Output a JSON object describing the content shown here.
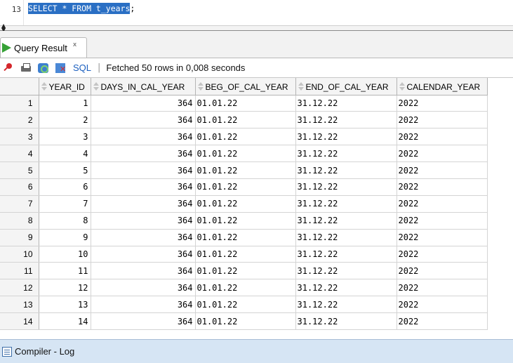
{
  "editor": {
    "line_number": "13",
    "selected_code": "SELECT * FROM t_years",
    "code_suffix": ";"
  },
  "result_tab": {
    "label": "Query Result",
    "close_glyph": "x",
    "icon": "run-triangle-icon"
  },
  "toolbar": {
    "icons": [
      "pin-icon",
      "print-icon",
      "refresh-icon",
      "delete-icon"
    ],
    "sql_link": "SQL",
    "separator": "|",
    "status": "Fetched 50 rows in 0,008 seconds"
  },
  "grid": {
    "columns": [
      "YEAR_ID",
      "DAYS_IN_CAL_YEAR",
      "BEG_OF_CAL_YEAR",
      "END_OF_CAL_YEAR",
      "CALENDAR_YEAR"
    ],
    "rows": [
      {
        "n": "1",
        "year_id": "1",
        "days": "364",
        "beg": "01.01.22",
        "end": "31.12.22",
        "cal": "2022"
      },
      {
        "n": "2",
        "year_id": "2",
        "days": "364",
        "beg": "01.01.22",
        "end": "31.12.22",
        "cal": "2022"
      },
      {
        "n": "3",
        "year_id": "3",
        "days": "364",
        "beg": "01.01.22",
        "end": "31.12.22",
        "cal": "2022"
      },
      {
        "n": "4",
        "year_id": "4",
        "days": "364",
        "beg": "01.01.22",
        "end": "31.12.22",
        "cal": "2022"
      },
      {
        "n": "5",
        "year_id": "5",
        "days": "364",
        "beg": "01.01.22",
        "end": "31.12.22",
        "cal": "2022"
      },
      {
        "n": "6",
        "year_id": "6",
        "days": "364",
        "beg": "01.01.22",
        "end": "31.12.22",
        "cal": "2022"
      },
      {
        "n": "7",
        "year_id": "7",
        "days": "364",
        "beg": "01.01.22",
        "end": "31.12.22",
        "cal": "2022"
      },
      {
        "n": "8",
        "year_id": "8",
        "days": "364",
        "beg": "01.01.22",
        "end": "31.12.22",
        "cal": "2022"
      },
      {
        "n": "9",
        "year_id": "9",
        "days": "364",
        "beg": "01.01.22",
        "end": "31.12.22",
        "cal": "2022"
      },
      {
        "n": "10",
        "year_id": "10",
        "days": "364",
        "beg": "01.01.22",
        "end": "31.12.22",
        "cal": "2022"
      },
      {
        "n": "11",
        "year_id": "11",
        "days": "364",
        "beg": "01.01.22",
        "end": "31.12.22",
        "cal": "2022"
      },
      {
        "n": "12",
        "year_id": "12",
        "days": "364",
        "beg": "01.01.22",
        "end": "31.12.22",
        "cal": "2022"
      },
      {
        "n": "13",
        "year_id": "13",
        "days": "364",
        "beg": "01.01.22",
        "end": "31.12.22",
        "cal": "2022"
      },
      {
        "n": "14",
        "year_id": "14",
        "days": "364",
        "beg": "01.01.22",
        "end": "31.12.22",
        "cal": "2022"
      }
    ]
  },
  "bottom_panel": {
    "label": "Compiler - Log",
    "icon": "log-icon"
  },
  "colors": {
    "selection": "#2a6fc4",
    "sql_link": "#1b5fbf",
    "bottom_bar": "#d6e5f4",
    "run_icon": "#36a136"
  }
}
